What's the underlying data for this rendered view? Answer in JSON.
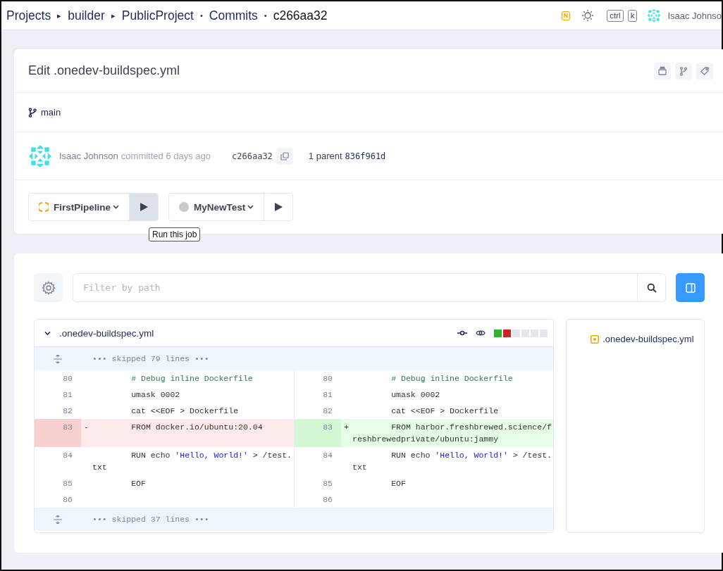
{
  "breadcrumbs": [
    {
      "label": "Projects",
      "separator": "▸",
      "current": false
    },
    {
      "label": "builder",
      "separator": "▸",
      "current": false
    },
    {
      "label": "PublicProject",
      "separator": "•",
      "current": false
    },
    {
      "label": "Commits",
      "separator": "•",
      "current": false
    },
    {
      "label": "c266aa32",
      "current": true
    }
  ],
  "topbar": {
    "badge": "N",
    "shortcut_keys": [
      "ctrl",
      "k"
    ],
    "user": "Isaac Johnso"
  },
  "commit": {
    "title": "Edit .onedev-buildspec.yml",
    "branch": "main",
    "author": "Isaac Johnson",
    "when": "committed 6 days ago",
    "hash": "c266aa32",
    "parent_label": "1 parent",
    "parent_hash": "836f961d"
  },
  "jobs": [
    {
      "name": "FirstPipeline",
      "kind": "running",
      "run_hovered": true,
      "run_tooltip": "Run this job"
    },
    {
      "name": "MyNewTest",
      "kind": "waiting",
      "run_hovered": false
    }
  ],
  "filter": {
    "placeholder": "Filter by path"
  },
  "file_tree_toggle": {
    "on": true
  },
  "diff": {
    "file": ".onedev-buildspec.yml",
    "expanded": true,
    "stat_blocks": [
      {
        "color": "#2fb52f"
      },
      {
        "color": "#c62828"
      },
      {
        "color": "#e4e6ef"
      },
      {
        "color": "#e4e6ef"
      },
      {
        "color": "#e4e6ef"
      },
      {
        "color": "#e4e6ef"
      }
    ],
    "rows": [
      {
        "kind": "skip",
        "text": "••• skipped 79 lines •••"
      },
      {
        "kind": "line",
        "left": {
          "number": "80",
          "kind": "context",
          "segments": [
            {
              "kind": "comment",
              "text": "        # Debug inline Dockerfile"
            }
          ]
        },
        "right": {
          "number": "80",
          "kind": "context",
          "segments": [
            {
              "kind": "comment",
              "text": "        # Debug inline Dockerfile"
            }
          ]
        }
      },
      {
        "kind": "line",
        "left": {
          "number": "81",
          "kind": "context",
          "segments": [
            {
              "kind": "plain",
              "text": "        umask 0002"
            }
          ]
        },
        "right": {
          "number": "81",
          "kind": "context",
          "segments": [
            {
              "kind": "plain",
              "text": "        umask 0002"
            }
          ]
        }
      },
      {
        "kind": "line",
        "left": {
          "number": "82",
          "kind": "context",
          "segments": [
            {
              "kind": "plain",
              "text": "        cat <<EOF > Dockerfile"
            }
          ]
        },
        "right": {
          "number": "82",
          "kind": "context",
          "segments": [
            {
              "kind": "plain",
              "text": "        cat <<EOF > Dockerfile"
            }
          ]
        }
      },
      {
        "kind": "line",
        "left": {
          "number": "83",
          "kind": "deleted",
          "marker": "-",
          "segments": [
            {
              "kind": "plain",
              "text": "        FROM docker.io/ubuntu:20.04"
            }
          ]
        },
        "right": {
          "number": "83",
          "kind": "added",
          "marker": "+",
          "segments": [
            {
              "kind": "plain",
              "text": "        FROM harbor.freshbrewed.science/freshbrewedprivate/ubuntu:jammy"
            }
          ]
        }
      },
      {
        "kind": "line",
        "left": {
          "number": "84",
          "kind": "context",
          "segments": [
            {
              "kind": "plain",
              "text": "        RUN echo "
            },
            {
              "kind": "string",
              "text": "'Hello, World!'"
            },
            {
              "kind": "plain",
              "text": " > /test.txt"
            }
          ]
        },
        "right": {
          "number": "84",
          "kind": "context",
          "segments": [
            {
              "kind": "plain",
              "text": "        RUN echo "
            },
            {
              "kind": "string",
              "text": "'Hello, World!'"
            },
            {
              "kind": "plain",
              "text": " > /test.txt"
            }
          ]
        }
      },
      {
        "kind": "line",
        "left": {
          "number": "85",
          "kind": "context",
          "segments": [
            {
              "kind": "plain",
              "text": "        EOF"
            }
          ]
        },
        "right": {
          "number": "85",
          "kind": "context",
          "segments": [
            {
              "kind": "plain",
              "text": "        EOF"
            }
          ]
        }
      },
      {
        "kind": "line",
        "left": {
          "number": "86",
          "kind": "context"
        },
        "right": {
          "number": "86",
          "kind": "context"
        }
      },
      {
        "kind": "skip",
        "text": "••• skipped 37 lines •••"
      }
    ]
  },
  "file_tree": [
    {
      "name": ".onedev-buildspec.yml"
    }
  ]
}
